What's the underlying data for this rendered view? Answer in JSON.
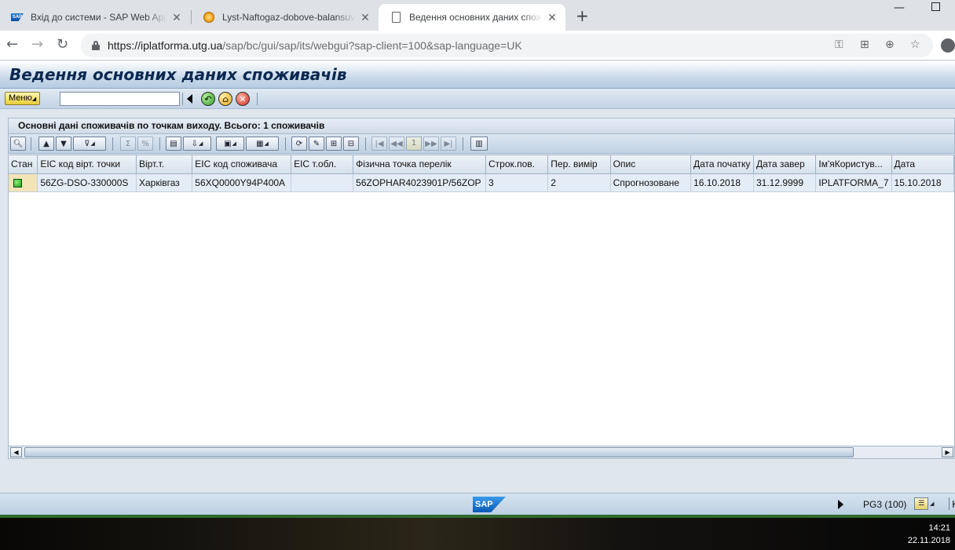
{
  "browser": {
    "tabs": [
      {
        "title": "Вхід до системи - SAP Web Appl",
        "icon": "sap-icon",
        "active": false
      },
      {
        "title": "Lyst-Naftogaz-dobove-balansuva",
        "icon": "orange-sphere-icon",
        "active": false
      },
      {
        "title": "Ведення основних даних спожи",
        "icon": "document-icon",
        "active": true
      }
    ],
    "url_host": "https://iplatforma.utg.ua",
    "url_path": "/sap/bc/gui/sap/its/webgui?sap-client=100&sap-language=UK"
  },
  "sap": {
    "title": "Ведення основних даних споживачів",
    "menu_label": "Меню",
    "command_value": "",
    "alv_title": "Основні дані споживачів по точкам виходу. Всього: 1 споживачів",
    "page_number": "1",
    "columns": [
      "Стан",
      "EIC код вірт. точки",
      "Вірт.т.",
      "EIC код споживача",
      "EIC т.обл.",
      "Фізична точка перелік",
      "Строк.пов.",
      "Пер. вимір",
      "Опис",
      "Дата початку",
      "Дата завер",
      "Ім'яКористув...",
      "Дата"
    ],
    "rows": [
      {
        "status": "green",
        "cells": [
          "",
          "56ZG-DSO-330000S",
          "Харківгаз",
          "56XQ0000Y94P400A",
          "",
          "56ZOPHAR4023901P/56ZOP",
          "3",
          "2",
          "Спрогнозоване",
          "16.10.2018",
          "31.12.9999",
          "IPLATFORMA_7",
          "15.10.2018"
        ]
      }
    ]
  },
  "statusbar": {
    "system": "PG3 (100)",
    "logo": "SAP",
    "edge_text": "К"
  },
  "taskbar": {
    "time": "14:21",
    "date": "22.11.2018"
  },
  "colors": {
    "sap_title_text": "#0a2850",
    "led_green": "#1aa012",
    "row_bg": "#e4ecf6"
  }
}
